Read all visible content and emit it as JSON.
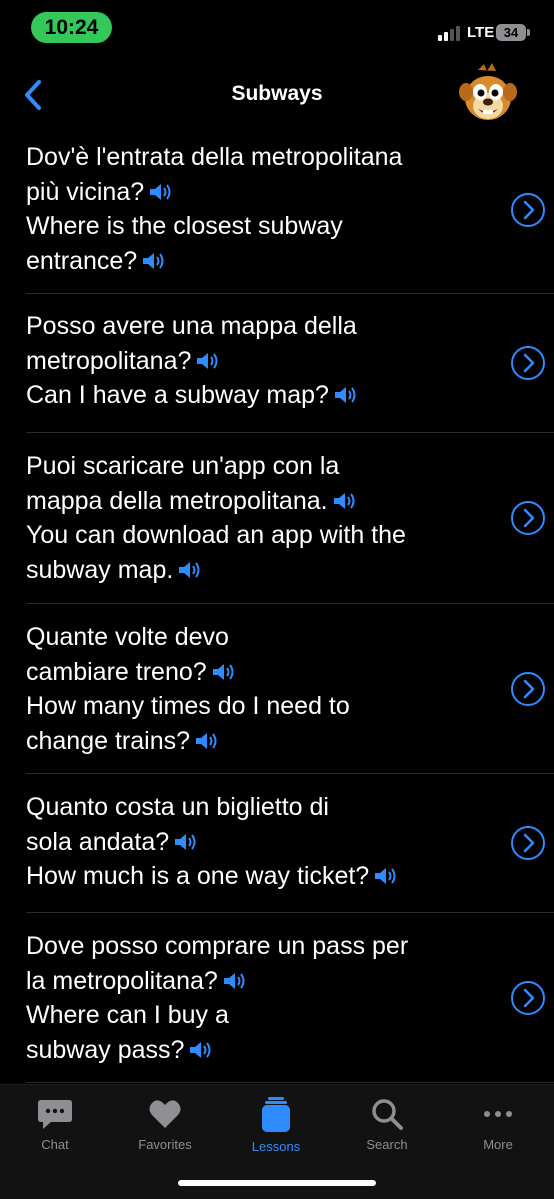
{
  "status": {
    "time": "10:24",
    "network": "LTE",
    "battery": "34"
  },
  "nav": {
    "title": "Subways"
  },
  "accent": "#2f8cff",
  "phrases": [
    {
      "lines": [
        "Dov'è l'entrata della metropolitana",
        "più vicina?"
      ],
      "translation": [
        "Where is the closest subway",
        "entrance?"
      ]
    },
    {
      "lines": [
        "Posso avere una mappa della",
        "metropolitana?"
      ],
      "translation": [
        "Can I have a subway map?"
      ]
    },
    {
      "lines": [
        "Puoi scaricare un'app con la",
        "mappa della metropolitana."
      ],
      "translation": [
        "You can download an app with the",
        "subway map."
      ]
    },
    {
      "lines": [
        "Quante volte devo",
        "cambiare treno?"
      ],
      "translation": [
        "How many times do I need to",
        "change trains?"
      ]
    },
    {
      "lines": [
        "Quanto costa un biglietto di",
        "sola andata?"
      ],
      "translation": [
        "How much is a one way ticket?"
      ]
    },
    {
      "lines": [
        "Dove posso comprare un pass per",
        "la metropolitana?"
      ],
      "translation": [
        "Where can I buy a",
        "subway pass?"
      ]
    }
  ],
  "tabs": [
    {
      "label": "Chat",
      "icon": "chat-bubble-icon",
      "active": false
    },
    {
      "label": "Favorites",
      "icon": "heart-icon",
      "active": false
    },
    {
      "label": "Lessons",
      "icon": "lessons-icon",
      "active": true
    },
    {
      "label": "Search",
      "icon": "search-icon",
      "active": false
    },
    {
      "label": "More",
      "icon": "more-dots-icon",
      "active": false
    }
  ]
}
